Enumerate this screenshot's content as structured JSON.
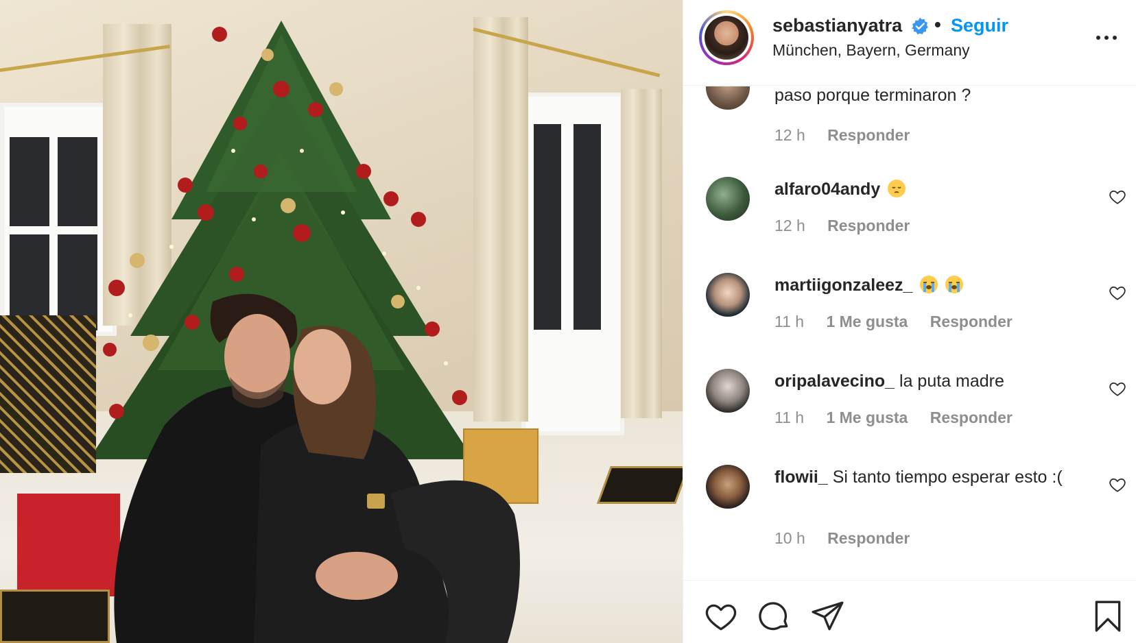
{
  "post": {
    "username": "sebastianyatra",
    "separator": "•",
    "follow_label": "Seguir",
    "location": "München, Bayern, Germany"
  },
  "comments": [
    {
      "username": "",
      "text": "paso porque terminaron ?",
      "time": "12 h",
      "likes": "",
      "reply_label": "Responder"
    },
    {
      "username": "alfaro04andy",
      "text": "",
      "emoji": [
        "pensive-face-emoji"
      ],
      "time": "12 h",
      "likes": "",
      "reply_label": "Responder"
    },
    {
      "username": "martiigonzaleez_",
      "text": "",
      "emoji": [
        "loudly-crying-face-emoji",
        "loudly-crying-face-emoji"
      ],
      "time": "11 h",
      "likes": "1 Me gusta",
      "reply_label": "Responder"
    },
    {
      "username": "oripalavecino_",
      "text": "la puta madre",
      "time": "11 h",
      "likes": "1 Me gusta",
      "reply_label": "Responder"
    },
    {
      "username": "flowii_",
      "text": "Si tanto tiempo esperar esto :(",
      "time": "10 h",
      "likes": "",
      "reply_label": "Responder"
    }
  ],
  "icons": {
    "verified": "verified-badge-icon",
    "more": "more-options-icon",
    "like": "heart-icon",
    "comment": "comment-bubble-icon",
    "share": "paper-plane-icon",
    "save": "bookmark-icon"
  },
  "colors": {
    "accent": "#0095f6",
    "text": "#262626",
    "muted": "#8e8e8e",
    "border": "#efefef"
  }
}
